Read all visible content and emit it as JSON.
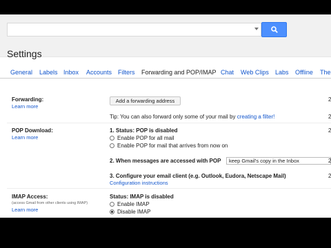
{
  "search": {
    "value": "",
    "button_label": "search"
  },
  "page_title": "Settings",
  "tabs": [
    {
      "label": "General"
    },
    {
      "label": "Labels"
    },
    {
      "label": "Inbox"
    },
    {
      "label": "Accounts"
    },
    {
      "label": "Filters"
    },
    {
      "label": "Forwarding and POP/IMAP",
      "active": true
    },
    {
      "label": "Chat"
    },
    {
      "label": "Web Clips"
    },
    {
      "label": "Labs"
    },
    {
      "label": "Offline"
    },
    {
      "label": "Themes"
    }
  ],
  "forwarding": {
    "label": "Forwarding:",
    "learn_more": "Learn more",
    "add_button": "Add a forwarding address",
    "tip_prefix": "Tip: You can also forward only some of your mail by",
    "tip_link": "creating a filter!"
  },
  "pop": {
    "label": "POP Download:",
    "learn_more": "Learn more",
    "status": "1. Status: POP is disabled",
    "option_all": "Enable POP for all mail",
    "option_new": "Enable POP for mail that arrives from now on",
    "step2": "2. When messages are accessed with POP",
    "step2_select": "keep Gmail's copy in the Inbox",
    "step3": "3. Configure your email client (e.g. Outlook, Eudora, Netscape Mail)",
    "config_link": "Configuration instructions"
  },
  "imap": {
    "label": "IMAP Access:",
    "note": "(access Gmail from other clients using IMAP)",
    "learn_more": "Learn more",
    "status": "Status: IMAP is disabled",
    "option_enable": "Enable IMAP",
    "option_disable": "Disable IMAP"
  },
  "edge_numbers": [
    "2",
    "2",
    "2",
    "2",
    "2"
  ],
  "colors": {
    "link": "#1155cc",
    "search_button": "#4d90fe"
  }
}
